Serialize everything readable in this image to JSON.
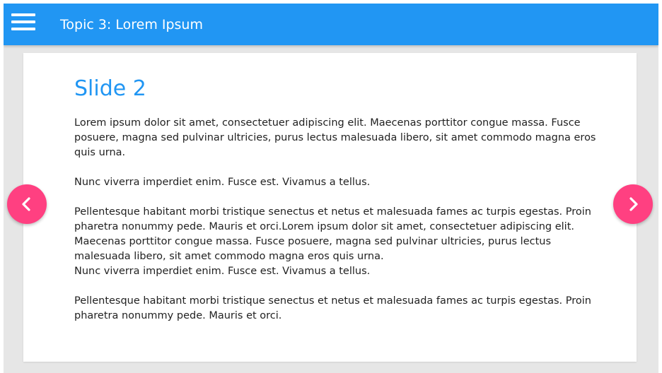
{
  "app_bar": {
    "title": "Topic 3: Lorem Ipsum",
    "menu_icon": "hamburger-menu-icon",
    "color": "#2196f3"
  },
  "slide": {
    "title": "Slide 2",
    "paragraphs": [
      "Lorem ipsum dolor sit amet, consectetuer adipiscing elit. Maecenas porttitor congue massa. Fusce posuere, magna sed pulvinar ultricies, purus lectus malesuada libero, sit amet commodo magna eros quis urna.",
      "Nunc viverra imperdiet enim. Fusce est. Vivamus a tellus.",
      "Pellentesque habitant morbi tristique senectus et netus et malesuada fames ac turpis egestas. Proin pharetra nonummy pede. Mauris et orci.Lorem ipsum dolor sit amet, consectetuer adipiscing elit. Maecenas porttitor congue massa. Fusce posuere, magna sed pulvinar ultricies, purus lectus malesuada libero, sit amet commodo magna eros quis urna.\nNunc viverra imperdiet enim. Fusce est. Vivamus a tellus.",
      "Pellentesque habitant morbi tristique senectus et netus et malesuada fames ac turpis egestas. Proin pharetra nonummy pede. Mauris et orci."
    ]
  },
  "navigation": {
    "prev_icon": "chevron-left-icon",
    "next_icon": "chevron-right-icon",
    "color": "#ff4081"
  }
}
